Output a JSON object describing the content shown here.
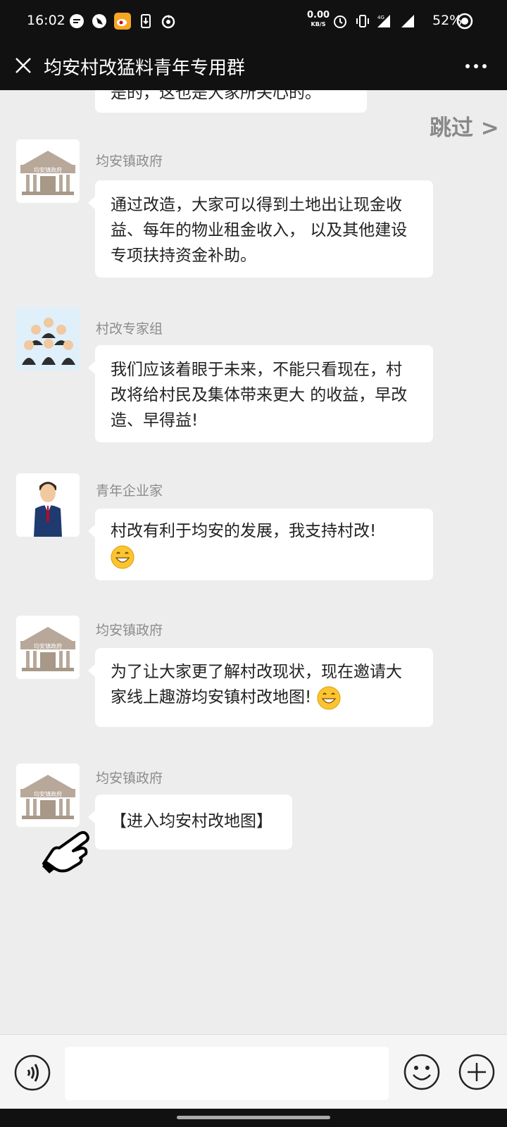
{
  "status_bar": {
    "time": "16:02",
    "net_speed": "0.00",
    "net_unit": "KB/S",
    "battery": "52%",
    "icons": [
      "message-icon",
      "hand-icon",
      "weibo-icon",
      "download-icon",
      "sync-icon",
      "alarm-icon",
      "vibrate-icon",
      "signal-4g-icon",
      "signal-icon",
      "battery-icon"
    ]
  },
  "nav": {
    "title": "均安村改猛料青年专用群"
  },
  "chat": {
    "skip_label": "跳过 >",
    "partial_message": "是的，这也是大家所关心的。",
    "messages": [
      {
        "sender": "均安镇政府",
        "avatar": "government-building-icon",
        "avatar_label": "均安镇政府",
        "lines": [
          "通过改造，大家可以得到土地出让现金收",
          "益、每年的物业租金收入， 以及其他建设",
          "专项扶持资金补助。"
        ]
      },
      {
        "sender": "村改专家组",
        "avatar": "expert-group-icon",
        "lines": [
          "我们应该着眼于未来，不能只看现在，村",
          "改将给村民及集体带来更大 的收益，早改",
          "造、早得益!"
        ]
      },
      {
        "sender": "青年企业家",
        "avatar": "businessman-icon",
        "lines": [
          "村改有利于均安的发展，我支持村改!"
        ]
      },
      {
        "sender": "均安镇政府",
        "avatar": "government-building-icon",
        "avatar_label": "均安镇政府",
        "lines": [
          "为了让大家更了解村改现状，现在邀请大",
          "家线上趣游均安镇村改地图!"
        ]
      },
      {
        "sender": "均安镇政府",
        "avatar": "government-building-icon",
        "avatar_label": "均安镇政府",
        "lines": [
          "【进入均安村改地图】"
        ]
      }
    ]
  },
  "input": {
    "value": "",
    "placeholder": ""
  },
  "colors": {
    "bar_bg": "#111111",
    "chat_bg": "#ededed",
    "bubble_bg": "#ffffff",
    "sender_text": "#8c8c8c"
  }
}
